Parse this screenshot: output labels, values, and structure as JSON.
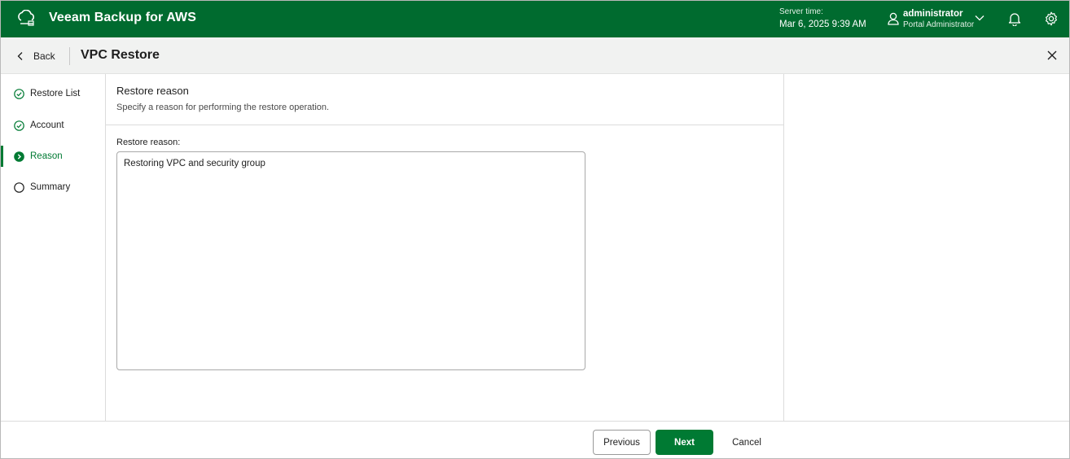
{
  "app": {
    "title": "Veeam Backup for AWS",
    "server_time_label": "Server time:",
    "server_time_value": "Mar 6, 2025 9:39 AM",
    "user_name": "administrator",
    "user_role": "Portal Administrator"
  },
  "subheader": {
    "back_label": "Back",
    "title": "VPC Restore"
  },
  "steps": [
    {
      "label": "Restore List",
      "state": "done"
    },
    {
      "label": "Account",
      "state": "done"
    },
    {
      "label": "Reason",
      "state": "active"
    },
    {
      "label": "Summary",
      "state": "pending"
    }
  ],
  "main": {
    "section_title": "Restore reason",
    "section_desc": "Specify a reason for performing the restore operation.",
    "field_label": "Restore reason:",
    "field_value": "Restoring VPC and security group"
  },
  "footer": {
    "previous_label": "Previous",
    "next_label": "Next",
    "cancel_label": "Cancel"
  },
  "colors": {
    "brand": "#006b2f",
    "accent": "#007a33"
  },
  "icons": {
    "logo": "veeam-cloud-icon",
    "user": "user-icon",
    "chevron": "chevron-down-icon",
    "bell": "bell-icon",
    "gear": "gear-icon",
    "back": "chevron-left-icon",
    "close": "close-icon",
    "step_done": "check-circle-icon",
    "step_active": "arrow-circle-icon",
    "step_pending": "empty-circle-icon"
  }
}
